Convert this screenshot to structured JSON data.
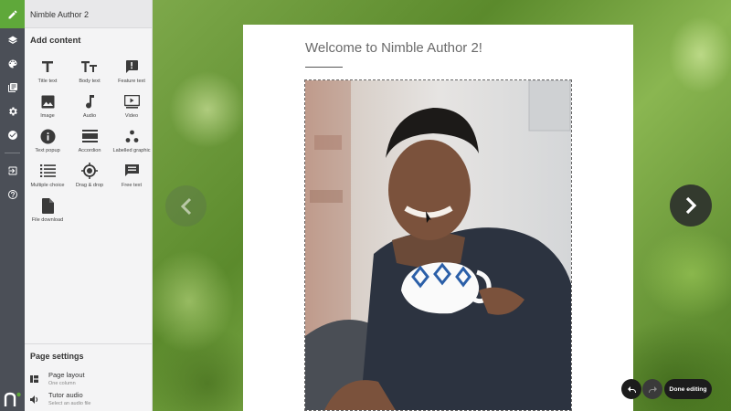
{
  "app": {
    "title": "Nimble Author 2"
  },
  "rail": {
    "items": [
      {
        "icon": "pencil-icon",
        "active": true
      },
      {
        "icon": "layers-icon"
      },
      {
        "icon": "palette-icon"
      },
      {
        "icon": "library-icon"
      },
      {
        "icon": "gear-icon"
      },
      {
        "icon": "check-circle-icon"
      },
      {
        "icon": "exit-icon"
      },
      {
        "icon": "help-icon"
      }
    ],
    "accent": "#5fa83a"
  },
  "panel": {
    "section_title": "Add content",
    "items": [
      {
        "label": "Title text",
        "icon": "title-text-icon"
      },
      {
        "label": "Body text",
        "icon": "body-text-icon"
      },
      {
        "label": "Feature text",
        "icon": "feature-text-icon"
      },
      {
        "label": "Image",
        "icon": "image-icon"
      },
      {
        "label": "Audio",
        "icon": "audio-icon"
      },
      {
        "label": "Video",
        "icon": "video-icon"
      },
      {
        "label": "Text popup",
        "icon": "info-icon"
      },
      {
        "label": "Accordion",
        "icon": "accordion-icon"
      },
      {
        "label": "Labelled graphic",
        "icon": "labelled-graphic-icon"
      },
      {
        "label": "Multiple choice",
        "icon": "list-icon"
      },
      {
        "label": "Drag & drop",
        "icon": "target-icon"
      },
      {
        "label": "Free text",
        "icon": "chat-icon"
      },
      {
        "label": "File download",
        "icon": "file-icon"
      }
    ]
  },
  "settings": {
    "title": "Page settings",
    "layout_label": "Page layout",
    "layout_value": "One column",
    "audio_label": "Tutor audio",
    "audio_value": "Select an audio file"
  },
  "page": {
    "title": "Welcome to Nimble Author 2!"
  },
  "controls": {
    "done_label": "Done editing"
  }
}
